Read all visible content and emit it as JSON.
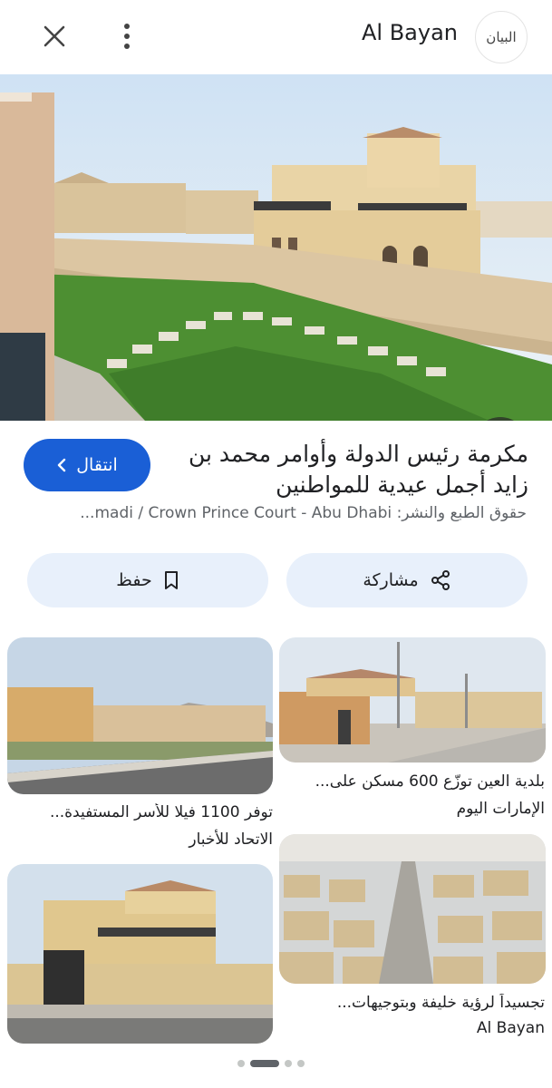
{
  "header": {
    "source_name": "Al Bayan",
    "logo_text": "البيان"
  },
  "result": {
    "title": "مكرمة رئيس الدولة وأوامر محمد بن زايد أجمل عيدية للمواطنين",
    "visit_label": "انتقال",
    "credit_label": "حقوق الطبع والنشر:",
    "credit_value": "...madi / Crown Prince Court - Abu Dhabi"
  },
  "actions": {
    "share_label": "مشاركة",
    "save_label": "حفظ"
  },
  "related": [
    {
      "title": "بلدية العين توزّع 600 مسكن على...",
      "source": "الإمارات اليوم"
    },
    {
      "title": "توفر 1100 فيلا للأسر المستفيدة...",
      "source": "الاتحاد للأخبار"
    },
    {
      "title": "تجسيداً لرؤية خليفة وبتوجيهات...",
      "source": "Al Bayan"
    }
  ],
  "pagination": {
    "count": 4,
    "active": 1
  },
  "colors": {
    "accent": "#1a5fd6",
    "pill_bg": "#e8f0fb"
  }
}
